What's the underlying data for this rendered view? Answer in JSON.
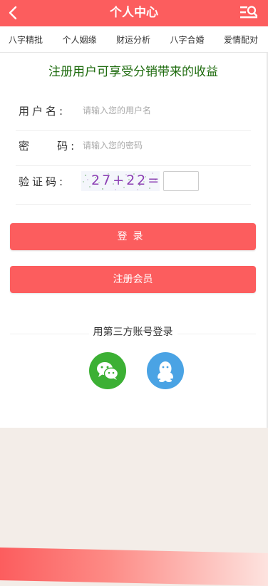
{
  "header": {
    "title": "个人中心",
    "back_icon": "chevron-left-icon",
    "menu_icon": "menu-search-icon",
    "bg_color": "#fc5d5e"
  },
  "tabs": [
    "八字精批",
    "个人姻缘",
    "财运分析",
    "八字合婚",
    "爱情配对"
  ],
  "promo": "注册用户可享受分销带来的收益",
  "form": {
    "username_label": "用户名:",
    "username_placeholder": "请输入您的用户名",
    "password_label": "密    码:",
    "password_placeholder": "请输入您的密码",
    "captcha_label": "验证码:",
    "captcha_text": "27+22=",
    "captcha_value": ""
  },
  "buttons": {
    "login": "登录",
    "register": "注册会员"
  },
  "third_party": {
    "title": "用第三方账号登录",
    "wechat_icon": "wechat-icon",
    "qq_icon": "qq-icon",
    "wechat_color": "#3cb034",
    "qq_color": "#4aa3e4"
  }
}
